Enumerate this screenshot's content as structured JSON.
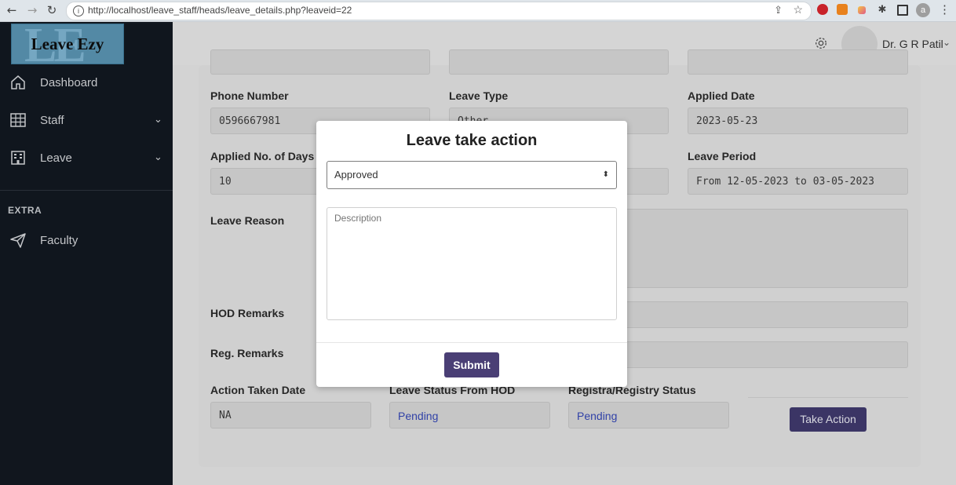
{
  "browser": {
    "url": "http://localhost/leave_staff/heads/leave_details.php?leaveid=22",
    "profile_initial": "a"
  },
  "sidebar": {
    "logo_text": "Leave Ezy",
    "items": [
      {
        "label": "Dashboard",
        "icon": "home-icon"
      },
      {
        "label": "Staff",
        "icon": "grid-icon"
      },
      {
        "label": "Leave",
        "icon": "building-icon"
      }
    ],
    "section_heading": "EXTRA",
    "extra_items": [
      {
        "label": "Faculty",
        "icon": "paper-plane-icon"
      }
    ]
  },
  "header": {
    "username": "Dr. G R Patil"
  },
  "details": {
    "phone_label": "Phone Number",
    "phone_value": "0596667981",
    "leave_type_label": "Leave Type",
    "leave_type_value": "Other",
    "applied_date_label": "Applied Date",
    "applied_date_value": "2023-05-23",
    "days_label": "Applied No. of Days",
    "days_value": "10",
    "period_label": "Leave Period",
    "period_value": "From 12-05-2023 to 03-05-2023",
    "reason_label": "Leave Reason",
    "hod_remarks_label": "HOD Remarks",
    "reg_remarks_label": "Reg. Remarks",
    "action_date_label": "Action Taken Date",
    "action_date_value": "NA",
    "hod_status_label": "Leave Status From HOD",
    "hod_status_value": "Pending",
    "registry_status_label": "Registra/Registry Status",
    "registry_status_value": "Pending",
    "take_action_label": "Take Action"
  },
  "modal": {
    "title": "Leave take action",
    "selected_option": "Approved",
    "description_placeholder": "Description",
    "submit_label": "Submit"
  },
  "colors": {
    "sidebar_bg": "#121821",
    "accent": "#4a3f75",
    "pending_text": "#3547b6"
  }
}
